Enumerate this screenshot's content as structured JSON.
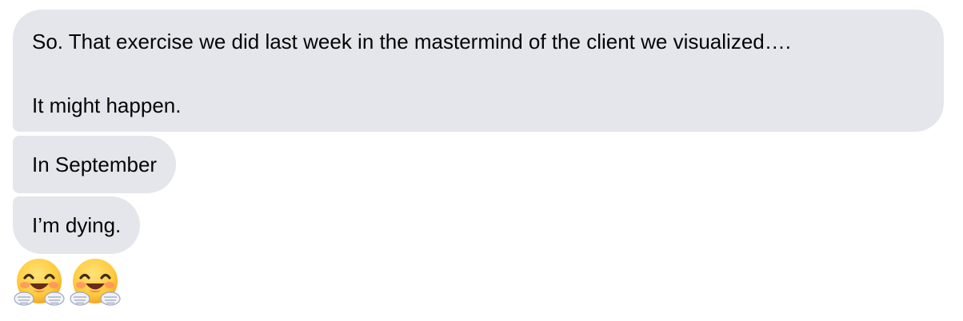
{
  "messages": [
    {
      "line1": "So. That exercise we did last week in the mastermind of the client we visualized….",
      "line2": "It might happen."
    },
    {
      "text": "In September"
    },
    {
      "text": "I’m dying."
    }
  ],
  "reactions": [
    "hugging-face-icon",
    "hugging-face-icon"
  ],
  "colors": {
    "bubble": "#e4e6eb",
    "text": "#050505",
    "emoji_face": "#ffcb3d",
    "emoji_cheek": "#ff8a65"
  }
}
